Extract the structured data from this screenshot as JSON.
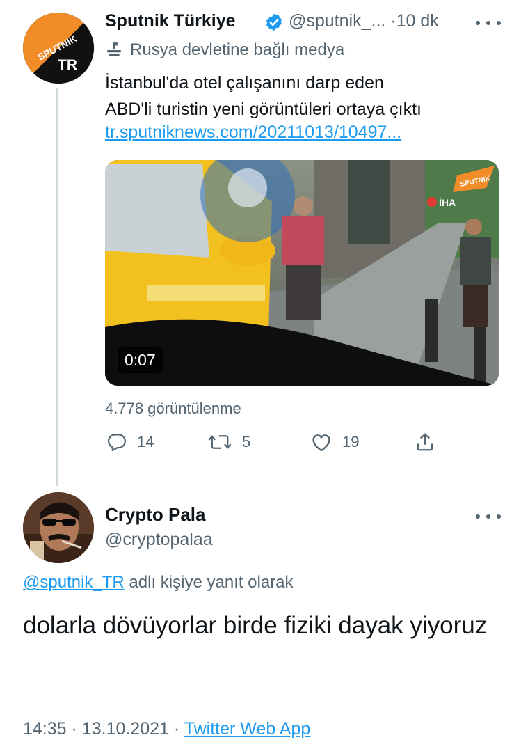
{
  "parent_tweet": {
    "author_name": "Sputnik Türkiye",
    "handle": "@sputnik_...",
    "separator": "·",
    "time": "10 dk",
    "avatar_text": {
      "top": "SPUTNIK",
      "bottom": "TR"
    },
    "state_label": "Rusya devletine bağlı medya",
    "text_line1": "İstanbul'da otel çalışanını darp eden",
    "text_line2": "ABD'li turistin yeni görüntüleri ortaya çıktı",
    "link": "tr.sputniknews.com/20211013/10497...",
    "video": {
      "duration": "0:07",
      "watermark_brand": "SPUTNIK",
      "watermark_agency": "İHA"
    },
    "views": "4.778 görüntülenme",
    "actions": {
      "replies": "14",
      "retweets": "5",
      "likes": "19"
    }
  },
  "reply_tweet": {
    "author_name": "Crypto Pala",
    "handle": "@cryptopalaa",
    "replying_to_handle": "@sputnik_TR",
    "replying_to_suffix": "adlı kişiye yanıt olarak",
    "text": "dolarla dövüyorlar birde fiziki dayak yiyoruz",
    "time": "14:35",
    "date": "13.10.2021",
    "separator": "·",
    "source": "Twitter Web App"
  },
  "colors": {
    "accent": "#1d9bf0",
    "secondary_text": "#536471",
    "thread_line": "#cfd9de",
    "sputnik_orange": "#f28c28"
  }
}
